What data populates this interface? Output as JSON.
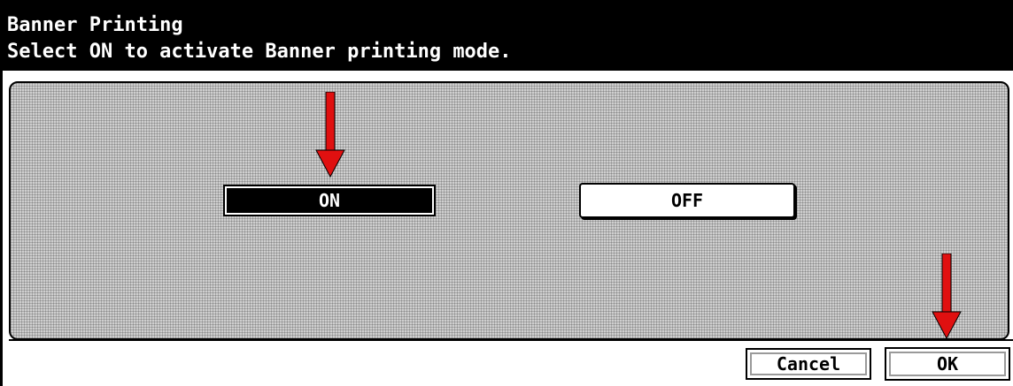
{
  "header": {
    "title": "Banner Printing",
    "instruction": "Select ON to activate Banner printing mode."
  },
  "options": {
    "on_label": "ON",
    "off_label": "OFF",
    "selected": "ON"
  },
  "footer": {
    "cancel_label": "Cancel",
    "ok_label": "OK"
  },
  "colors": {
    "header_bg": "#000000",
    "selected_bg": "#000000",
    "annotation_arrow": "#e01010"
  },
  "icons": [
    "annotation-arrow-down-icon"
  ]
}
